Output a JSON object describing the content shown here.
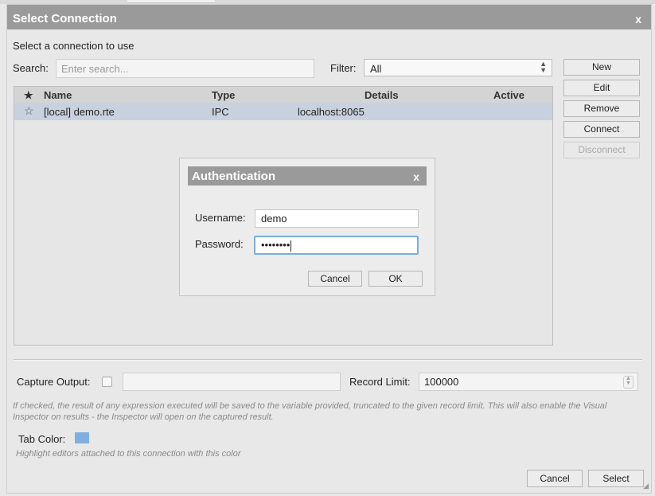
{
  "dialog": {
    "title": "Select Connection",
    "close_glyph": "x",
    "subtitle": "Select a connection to use"
  },
  "search": {
    "label": "Search:",
    "placeholder": "Enter search..."
  },
  "filter": {
    "label": "Filter:",
    "value": "All"
  },
  "side_buttons": {
    "new": "New",
    "edit": "Edit",
    "remove": "Remove",
    "connect": "Connect",
    "disconnect": "Disconnect"
  },
  "table": {
    "headers": {
      "star": "★",
      "name": "Name",
      "type": "Type",
      "details": "Details",
      "active": "Active"
    },
    "rows": [
      {
        "star": "☆",
        "name": "[local] demo.rte",
        "type": "IPC",
        "details": "localhost:8065",
        "active": ""
      }
    ],
    "selected_row_color": "#c8d1de"
  },
  "auth": {
    "title": "Authentication",
    "close_glyph": "x",
    "username_label": "Username:",
    "username_value": "demo",
    "password_label": "Password:",
    "password_value": "••••••••",
    "cancel": "Cancel",
    "ok": "OK"
  },
  "capture": {
    "label": "Capture Output:",
    "value": "",
    "record_limit_label": "Record Limit:",
    "record_limit_value": "100000",
    "hint": "If checked, the result of any expression executed will be saved to the variable provided, truncated to the given record limit. This will also enable the Visual Inspector on results - the Inspector will open on the captured result."
  },
  "tab_color": {
    "label": "Tab Color:",
    "color": "#7fb0e0",
    "hint": "Highlight editors attached to this connection with this color"
  },
  "footer": {
    "cancel": "Cancel",
    "select": "Select"
  },
  "colors": {
    "titlebar": "#9a9a9a",
    "focus_ring": "#7aaed8"
  }
}
